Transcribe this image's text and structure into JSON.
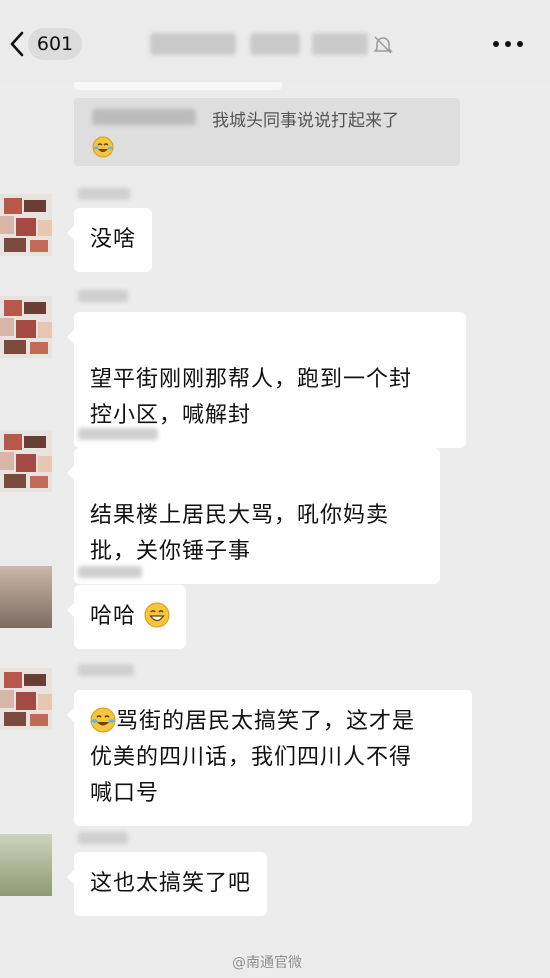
{
  "header": {
    "unread_count": "601"
  },
  "quote": {
    "text": "我城头同事说说打起来了",
    "emoji_icon": "tears-of-joy-emoji-icon"
  },
  "messages": [
    {
      "text": "没啥"
    },
    {
      "text": "望平街刚刚那帮人，跑到一个封\n控小区，喊解封"
    },
    {
      "text": "结果楼上居民大骂，吼你妈卖\n批，关你锤子事"
    },
    {
      "text": "哈哈",
      "trailing_emoji": "grinning-emoji-icon"
    },
    {
      "leading_emoji": "tears-of-joy-emoji-icon",
      "text": "骂街的居民太搞笑了，这才是\n优美的四川话，我们四川人不得\n喊口号"
    },
    {
      "text": "这也太搞笑了吧"
    }
  ],
  "watermark": "@南通官微",
  "colors": {
    "background": "#ececec",
    "bubble": "#ffffff",
    "quote_box": "#dedede"
  }
}
